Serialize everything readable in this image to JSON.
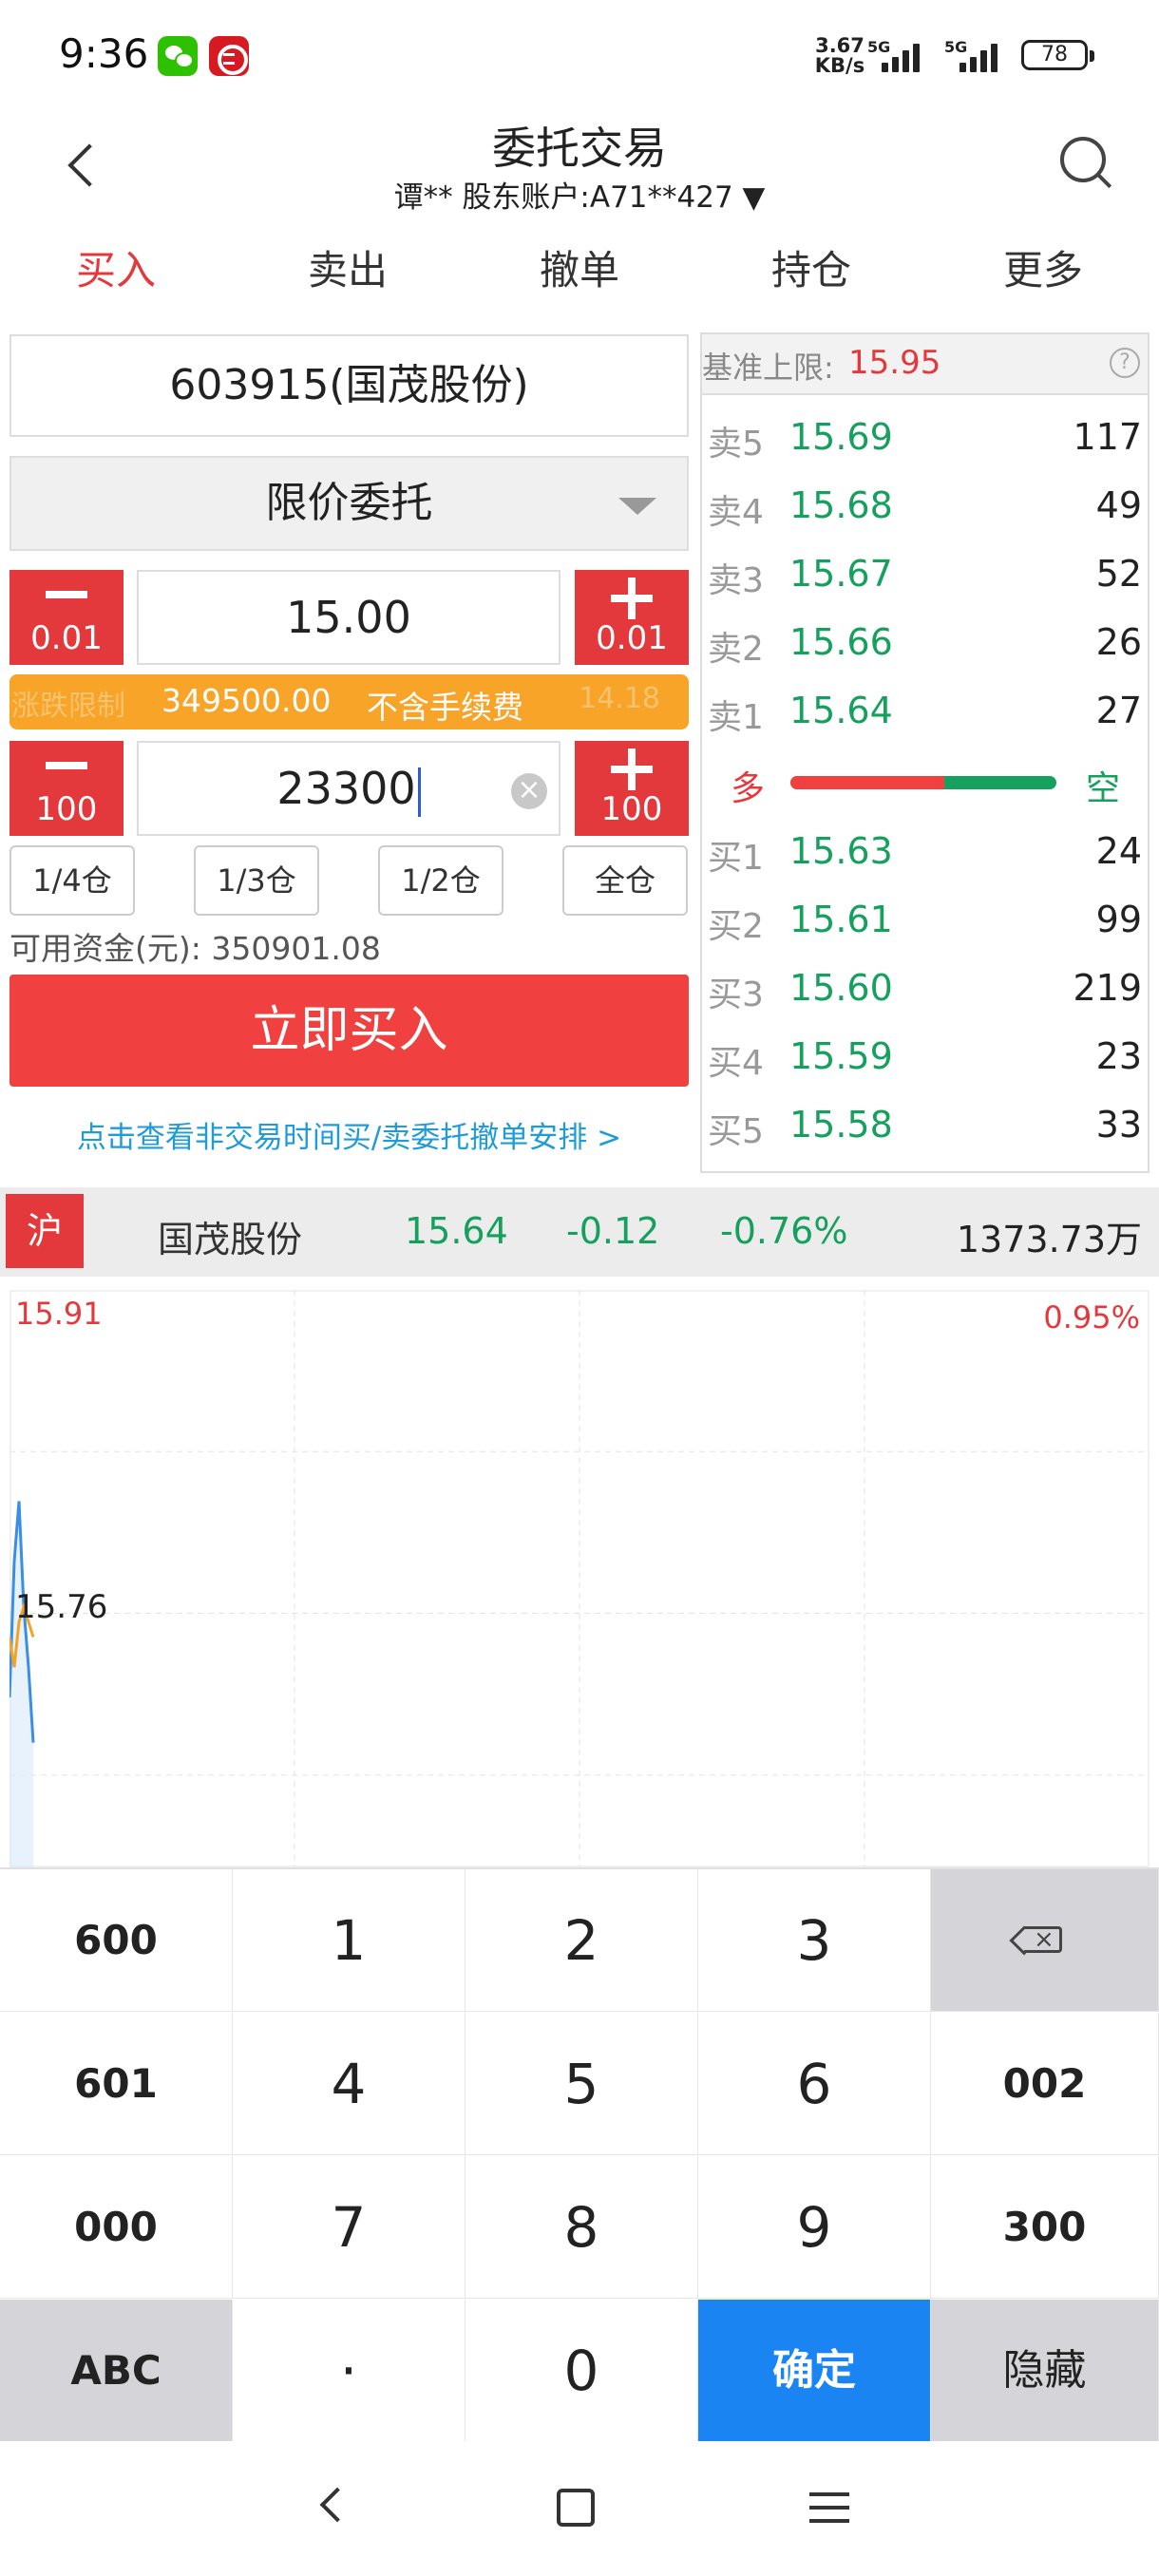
{
  "status_bar": {
    "time": "9:36",
    "speed": "3.67 KB/s",
    "network1": "5G",
    "network2": "5G",
    "battery": "78"
  },
  "header": {
    "title": "委托交易",
    "account": "谭**  股东账户:A71**427 ▼"
  },
  "tabs": [
    {
      "label": "买入"
    },
    {
      "label": "卖出"
    },
    {
      "label": "撤单"
    },
    {
      "label": "持仓"
    },
    {
      "label": "更多"
    }
  ],
  "form": {
    "stock": "603915(国茂股份)",
    "order_type": "限价委托",
    "price_step": "0.01",
    "price": "15.00",
    "limit_left": "涨跌限制",
    "limit_right": "14.18",
    "amount": "349500.00",
    "fee_note": "不含手续费",
    "qty_step": "100",
    "quantity": "23300",
    "positions": [
      "1/4仓",
      "1/3仓",
      "1/2仓",
      "全仓"
    ],
    "funds": "可用资金(元): 350901.08",
    "buy_label": "立即买入",
    "info_link": "点击查看非交易时间买/卖委托撤单安排 >"
  },
  "book": {
    "limit_label": "基准上限:",
    "limit_value": "15.95",
    "asks": [
      {
        "level": "卖5",
        "price": "15.69",
        "volume": "117"
      },
      {
        "level": "卖4",
        "price": "15.68",
        "volume": "49"
      },
      {
        "level": "卖3",
        "price": "15.67",
        "volume": "52"
      },
      {
        "level": "卖2",
        "price": "15.66",
        "volume": "26"
      },
      {
        "level": "卖1",
        "price": "15.64",
        "volume": "27"
      }
    ],
    "long_label": "多",
    "short_label": "空",
    "long_ratio": 0.58,
    "bids": [
      {
        "level": "买1",
        "price": "15.63",
        "volume": "24"
      },
      {
        "level": "买2",
        "price": "15.61",
        "volume": "99"
      },
      {
        "level": "买3",
        "price": "15.60",
        "volume": "219"
      },
      {
        "level": "买4",
        "price": "15.59",
        "volume": "23"
      },
      {
        "level": "买5",
        "price": "15.58",
        "volume": "33"
      }
    ]
  },
  "quote": {
    "exchange": "沪",
    "name": "国茂股份",
    "price": "15.64",
    "change": "-0.12",
    "change_pct": "-0.76%",
    "turnover": "1373.73万"
  },
  "chart_data": {
    "type": "line",
    "y_top_label": "15.91",
    "y_mid_label": "15.76",
    "pct_top_label": "0.95%",
    "ylim": [
      15.61,
      15.91
    ],
    "grid": true,
    "series": [
      {
        "color": "#3a8ee6",
        "x": [
          0,
          1,
          2,
          3,
          4,
          5
        ],
        "values": [
          15.64,
          15.73,
          15.77,
          15.7,
          15.66,
          15.61
        ]
      },
      {
        "color": "#f2a324",
        "x": [
          0,
          1,
          2,
          3,
          4,
          5
        ],
        "values": [
          15.68,
          15.66,
          15.69,
          15.7,
          15.69,
          15.68
        ]
      }
    ],
    "x_max": 240
  },
  "keyboard": {
    "rows": [
      [
        "600",
        "1",
        "2",
        "3",
        ""
      ],
      [
        "601",
        "4",
        "5",
        "6",
        "002"
      ],
      [
        "000",
        "7",
        "8",
        "9",
        "300"
      ],
      [
        "ABC",
        "·",
        "0",
        "确定",
        "隐藏"
      ]
    ]
  }
}
